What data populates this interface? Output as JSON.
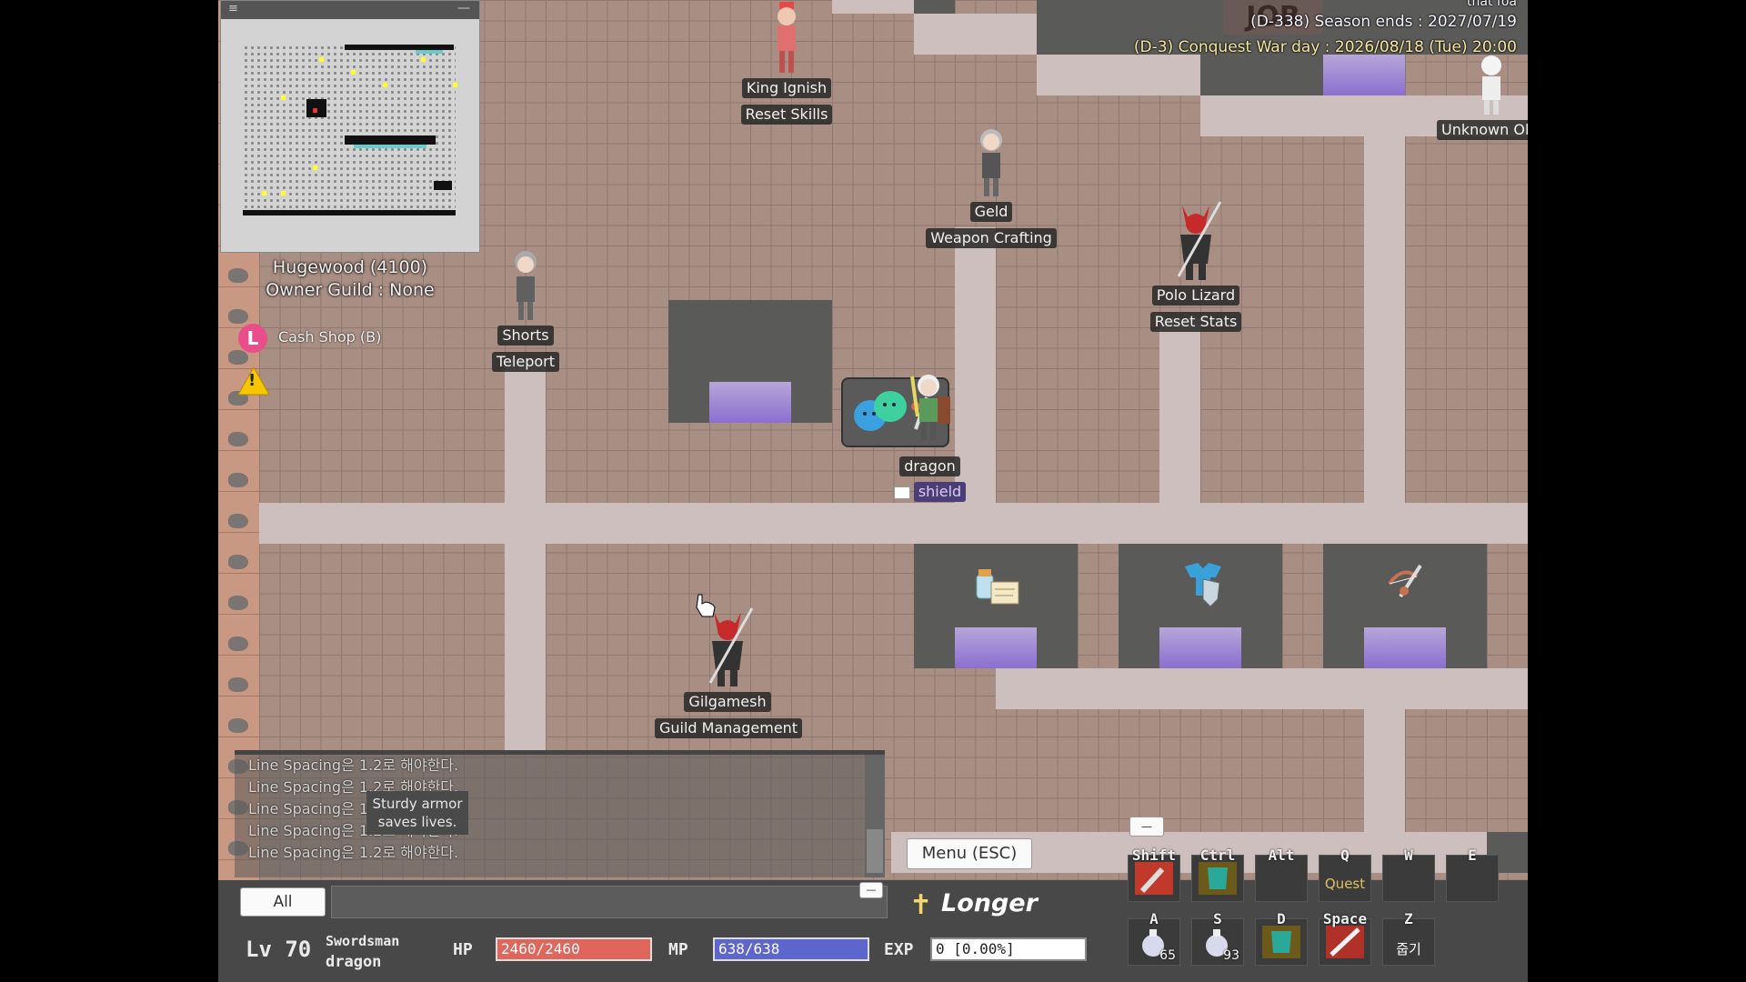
{
  "top_info": {
    "corner_label": "that foa",
    "season": "(D-338) Season ends : 2027/07/19",
    "war": "(D-3) Conquest War day : 2026/08/18 (Tue) 20:00",
    "sign": "JOB"
  },
  "location": {
    "name": "Hugewood (4100)",
    "owner": "Owner Guild : None"
  },
  "side": {
    "cash_badge": "L",
    "cash_label": "Cash Shop (B)",
    "warning_glyph": "!"
  },
  "npcs": [
    {
      "name": "King Ignish",
      "role": "Reset Skills"
    },
    {
      "name": "Geld",
      "role": "Weapon Crafting"
    },
    {
      "name": "Polo Lizard",
      "role": "Reset Stats"
    },
    {
      "name": "Shorts",
      "role": "Teleport"
    },
    {
      "name": "Gilgamesh",
      "role": "Guild Management"
    },
    {
      "name": "Unknown Ol"
    }
  ],
  "player": {
    "name": "dragon",
    "guild": "shield"
  },
  "chat": {
    "lines": [
      "Line Spacing은 1.2로 해야한다.",
      "Line Spacing은 1.2로 해야한다.",
      "Line Spacing은 1.2로 해야한다.",
      "Line Spacing은 1.2로 해야한다.",
      "Line Spacing은 1.2로 해야한다."
    ],
    "tooltip": "Sturdy armor saves lives.",
    "tab_all": "All",
    "minimize": "—"
  },
  "hud": {
    "level": "Lv 70",
    "job": "Swordsman",
    "name": "dragon",
    "hp_label": "HP",
    "hp_text": "2460/2460",
    "hp_fraction": 1.0,
    "mp_label": "MP",
    "mp_text": "638/638",
    "mp_fraction": 1.0,
    "exp_label": "EXP",
    "exp_text": "0 [0.00%]",
    "exp_fraction": 0.0,
    "menu": "Menu (ESC)",
    "buff": "Longer",
    "collapse": "—"
  },
  "hotkeys": [
    {
      "key": "Shift",
      "icon": "hammer-icon"
    },
    {
      "key": "Ctrl",
      "icon": "armor-icon"
    },
    {
      "key": "Alt",
      "icon": ""
    },
    {
      "key": "Q",
      "label": "Quest"
    },
    {
      "key": "W",
      "icon": ""
    },
    {
      "key": "E",
      "icon": ""
    },
    {
      "key": "A",
      "icon": "potion-icon",
      "count": "65"
    },
    {
      "key": "S",
      "icon": "potion-icon",
      "count": "93"
    },
    {
      "key": "D",
      "icon": "armor-icon"
    },
    {
      "key": "Space",
      "icon": "sword-icon"
    },
    {
      "key": "Z",
      "label": "줍기"
    }
  ],
  "colors": {
    "hp": "#e0665c",
    "mp": "#5c66cc",
    "exp": "#ffffff",
    "guild": "#4b3d75"
  }
}
